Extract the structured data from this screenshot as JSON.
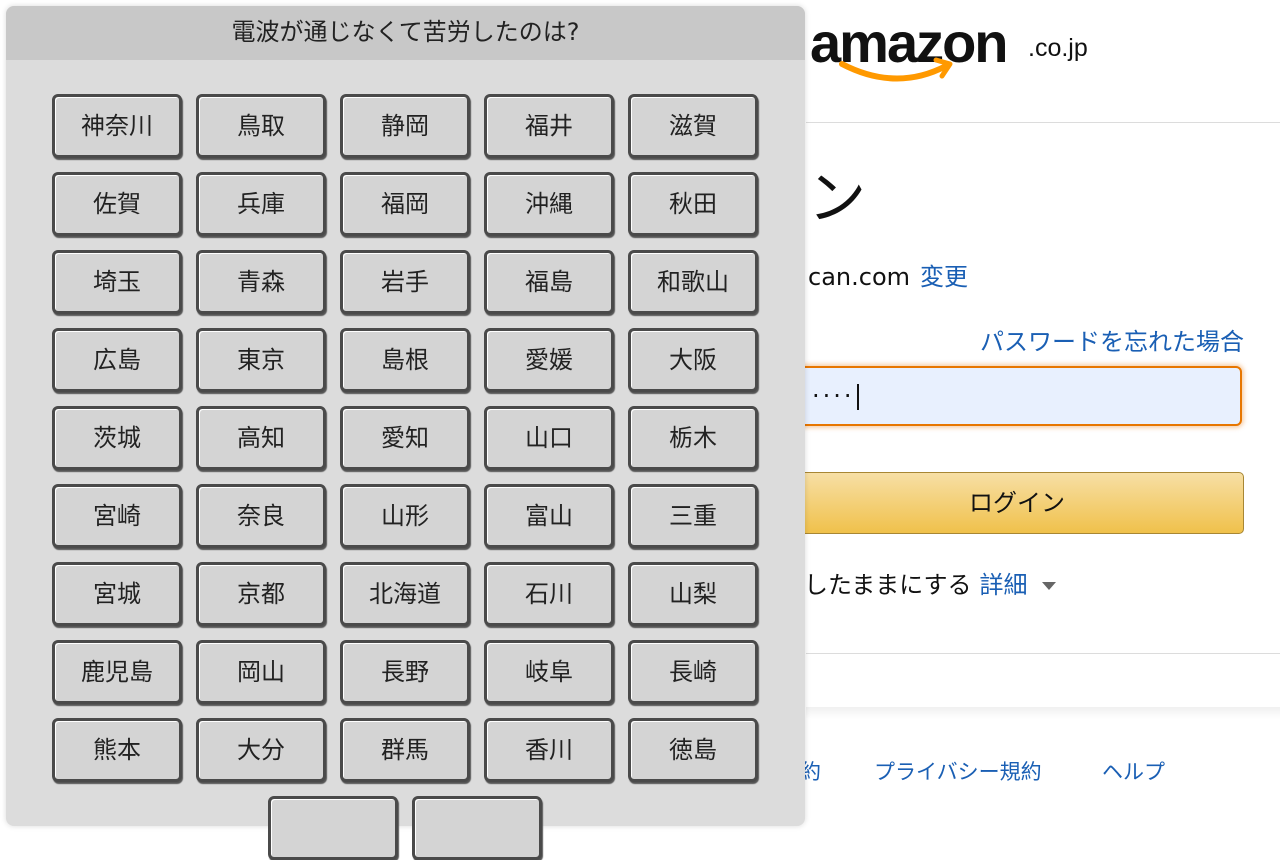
{
  "background_page": {
    "logo": {
      "word": "amazon",
      "suffix": ".co.jp"
    },
    "signin_title_fragment": "ン",
    "email_fragment": "can.com",
    "change_link": "変更",
    "forgot_password_link": "パスワードを忘れた場合",
    "password_masked": "····",
    "login_button": "ログイン",
    "keep_signed_in_fragment": "したままにする",
    "details_link": "詳細",
    "footer_links": [
      "約",
      "プライバシー規約",
      "ヘルプ"
    ],
    "colors": {
      "link": "#1a5fb4",
      "button_yellow": "#f0c14b",
      "input_focus": "#e77600"
    }
  },
  "overlay": {
    "question": "電波が通じなくて苦労したのは?",
    "prefectures": [
      "神奈川",
      "鳥取",
      "静岡",
      "福井",
      "滋賀",
      "佐賀",
      "兵庫",
      "福岡",
      "沖縄",
      "秋田",
      "埼玉",
      "青森",
      "岩手",
      "福島",
      "和歌山",
      "広島",
      "東京",
      "島根",
      "愛媛",
      "大阪",
      "茨城",
      "高知",
      "愛知",
      "山口",
      "栃木",
      "宮崎",
      "奈良",
      "山形",
      "富山",
      "三重",
      "宮城",
      "京都",
      "北海道",
      "石川",
      "山梨",
      "鹿児島",
      "岡山",
      "長野",
      "岐阜",
      "長崎",
      "熊本",
      "大分",
      "群馬",
      "香川",
      "徳島"
    ],
    "partial_row_buttons": [
      "",
      ""
    ]
  }
}
